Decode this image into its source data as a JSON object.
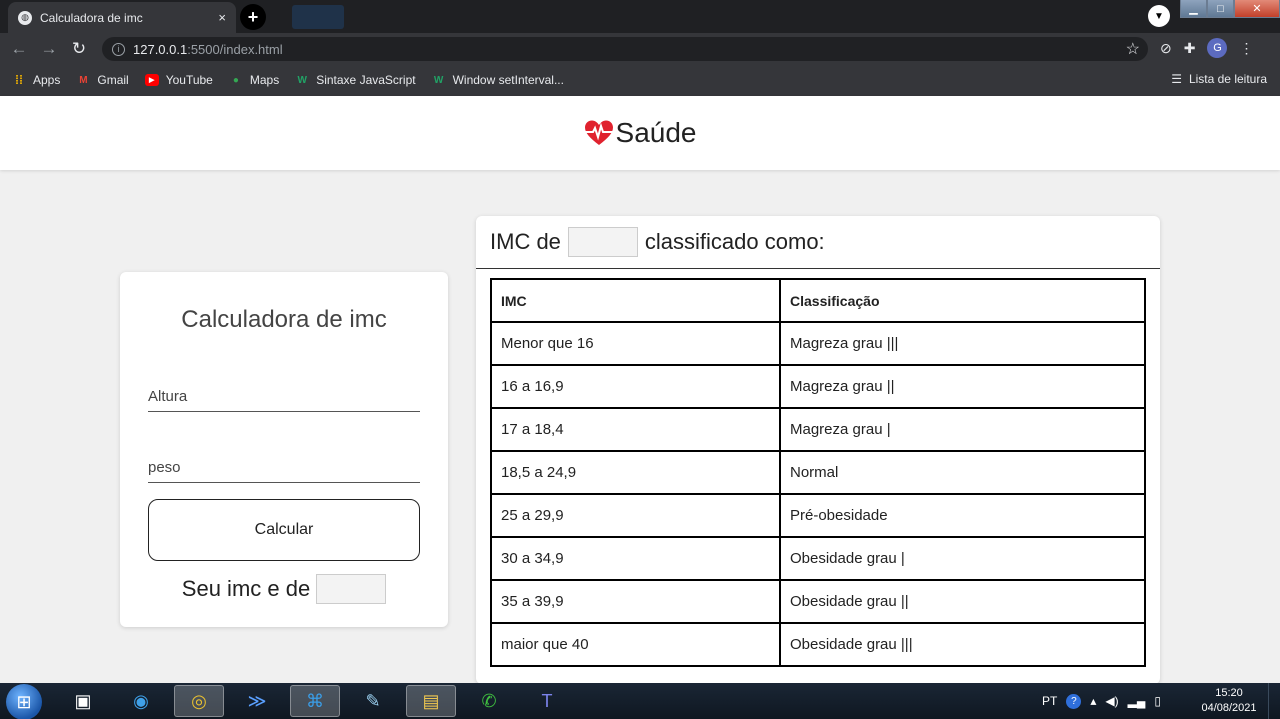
{
  "browser": {
    "tab_title": "Calculadora de imc",
    "tab_close": "×",
    "new_tab": "+",
    "url_host": "127.0.0.1",
    "url_path": ":5500/index.html",
    "bookmarks": [
      {
        "label": "Apps",
        "icon": "apps-grid-icon"
      },
      {
        "label": "Gmail",
        "icon": "gmail-icon"
      },
      {
        "label": "YouTube",
        "icon": "youtube-icon"
      },
      {
        "label": "Maps",
        "icon": "maps-icon"
      },
      {
        "label": "Sintaxe JavaScript",
        "icon": "w3schools-icon"
      },
      {
        "label": "Window setInterval...",
        "icon": "w3schools-icon"
      }
    ],
    "reading_list": "Lista de leitura",
    "avatar_letter": "G"
  },
  "header": {
    "brand": "Saúde",
    "heart_color": "#e0222e"
  },
  "calculator": {
    "title": "Calculadora de imc",
    "altura_placeholder": "Altura",
    "peso_placeholder": "peso",
    "button_label": "Calcular",
    "result_label": "Seu imc e de",
    "result_value": ""
  },
  "classification": {
    "heading_prefix": "IMC de",
    "heading_suffix": "classificado como:",
    "imc_value": "",
    "columns": [
      "IMC",
      "Classificação"
    ],
    "rows": [
      [
        "Menor que 16",
        "Magreza grau |||"
      ],
      [
        "16 a 16,9",
        "Magreza grau ||"
      ],
      [
        "17 a 18,4",
        "Magreza grau |"
      ],
      [
        "18,5 a 24,9",
        "Normal"
      ],
      [
        "25 a 29,9",
        "Pré-obesidade"
      ],
      [
        "30 a 34,9",
        "Obesidade grau |"
      ],
      [
        "35 a 39,9",
        "Obesidade grau ||"
      ],
      [
        "maior que 40",
        "Obesidade grau |||"
      ]
    ]
  },
  "taskbar": {
    "lang": "PT",
    "time": "15:20",
    "date": "04/08/2021"
  }
}
